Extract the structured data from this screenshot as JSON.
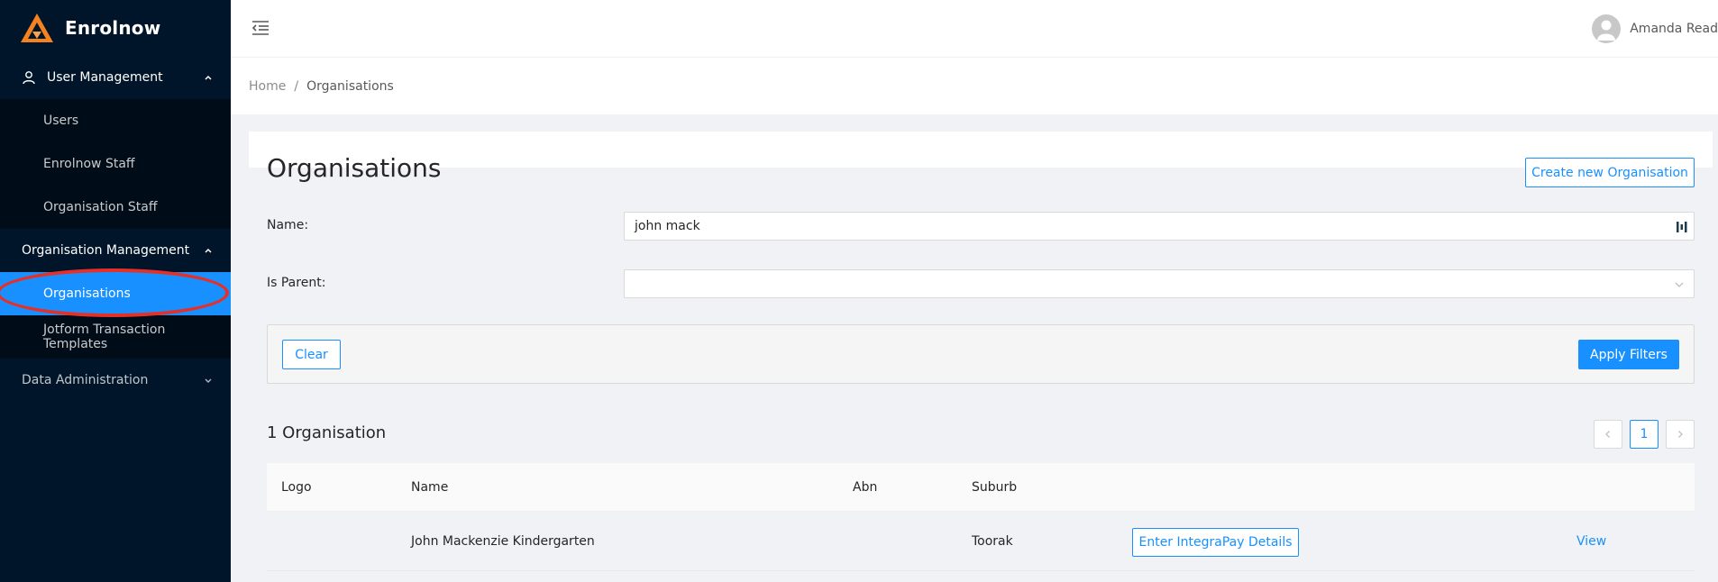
{
  "app": {
    "name": "Enrolnow"
  },
  "sidebar": {
    "groups": [
      {
        "title": "User Management",
        "expanded": true,
        "items": [
          "Users",
          "Enrolnow Staff",
          "Organisation Staff"
        ]
      },
      {
        "title": "Organisation Management",
        "expanded": true,
        "items": [
          "Organisations",
          "Jotform Transaction Templates"
        ]
      },
      {
        "title": "Data Administration",
        "expanded": false,
        "items": []
      }
    ],
    "active_item": "Organisations"
  },
  "header": {
    "user_name": "Amanda Read"
  },
  "breadcrumb": {
    "home": "Home",
    "separator": "/",
    "current": "Organisations"
  },
  "page": {
    "title": "Organisations",
    "create_button": "Create new Organisation"
  },
  "filters": {
    "name_label": "Name",
    "name_value": "john mack",
    "is_parent_label": "Is Parent",
    "is_parent_value": "",
    "clear_button": "Clear",
    "apply_button": "Apply Filters"
  },
  "results": {
    "count_title": "1 Organisation",
    "pagination": {
      "prev": "<",
      "current": "1",
      "next": ">"
    },
    "columns": [
      "Logo",
      "Name",
      "Abn",
      "Suburb"
    ],
    "rows": [
      {
        "logo": "",
        "name": "John Mackenzie Kindergarten",
        "abn": "",
        "suburb": "Toorak",
        "action_button": "Enter IntegraPay Details",
        "view_link": "View"
      }
    ]
  },
  "colors": {
    "sidebar_bg": "#001529",
    "submenu_bg": "#000c17",
    "primary": "#1890ff",
    "highlight_ring": "#e3312a",
    "logo_orange": "#f58220"
  }
}
